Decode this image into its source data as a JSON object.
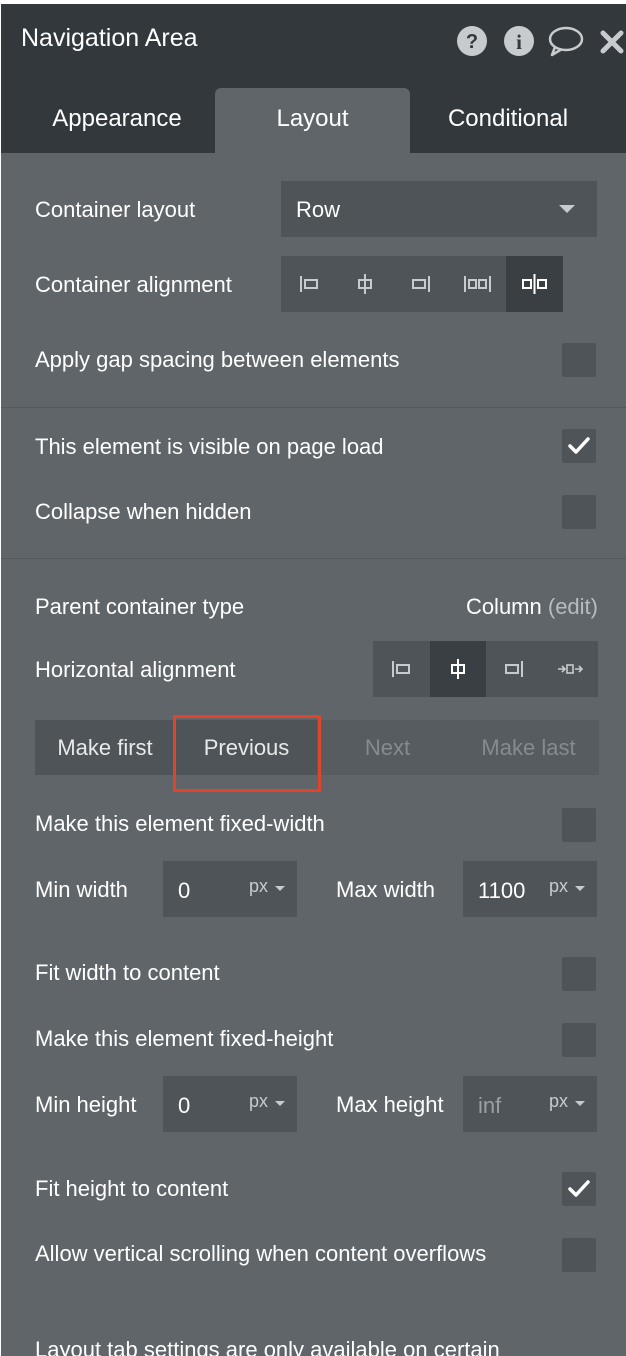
{
  "header": {
    "title": "Navigation Area",
    "icons": [
      "help-icon",
      "info-icon",
      "comment-icon",
      "close-icon"
    ]
  },
  "tabs": [
    {
      "label": "Appearance"
    },
    {
      "label": "Layout",
      "active": true
    },
    {
      "label": "Conditional"
    }
  ],
  "container": {
    "layout_label": "Container layout",
    "layout_value": "Row",
    "alignment_label": "Container alignment",
    "alignment_selected": 4,
    "gap_label": "Apply gap spacing between elements",
    "gap_checked": false
  },
  "visibility": {
    "visible_label": "This element is visible on page load",
    "visible_checked": true,
    "collapse_label": "Collapse when hidden",
    "collapse_checked": false
  },
  "parent": {
    "type_label": "Parent container type",
    "type_value": "Column",
    "edit_link": "(edit)",
    "halign_label": "Horizontal alignment",
    "halign_selected": 1
  },
  "order_buttons": {
    "make_first": "Make first",
    "previous": "Previous",
    "next": "Next",
    "make_last": "Make last"
  },
  "width": {
    "fixed_label": "Make this element fixed-width",
    "fixed_checked": false,
    "min_label": "Min width",
    "min_value": "0",
    "min_unit": "px",
    "max_label": "Max width",
    "max_value": "1100",
    "max_unit": "px",
    "fit_label": "Fit width to content",
    "fit_checked": false
  },
  "height": {
    "fixed_label": "Make this element fixed-height",
    "fixed_checked": false,
    "min_label": "Min height",
    "min_value": "0",
    "min_unit": "px",
    "max_label": "Max height",
    "max_placeholder": "inf",
    "max_unit": "px",
    "fit_label": "Fit height to content",
    "fit_checked": true,
    "scroll_label": "Allow vertical scrolling when content overflows",
    "scroll_checked": false
  },
  "footer_note": "Layout tab settings are only available on certain",
  "colors": {
    "panel_bg": "#5f6569",
    "header_bg": "#33383c",
    "input_bg": "#4e5458",
    "highlight": "#e0452c"
  }
}
